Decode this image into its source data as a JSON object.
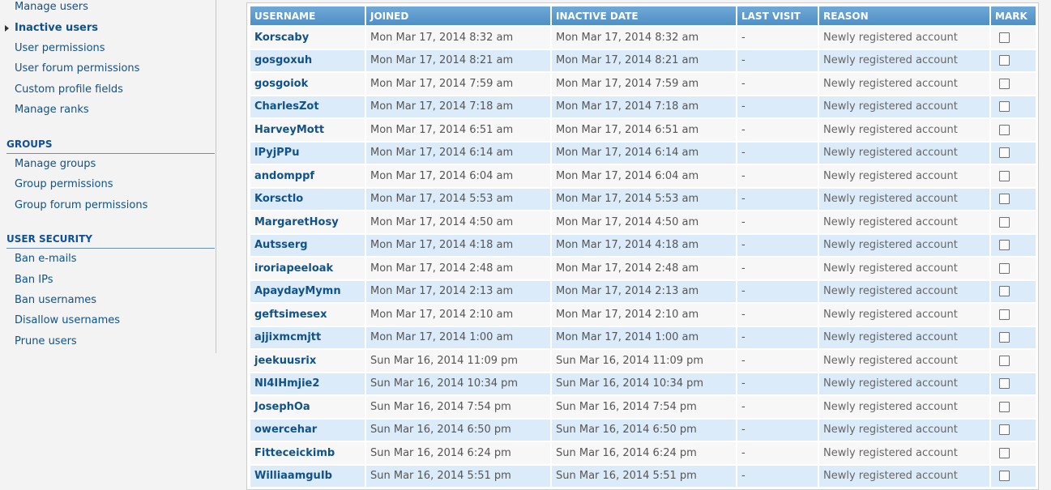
{
  "sidebar": {
    "users_items": [
      {
        "label": "Manage users"
      },
      {
        "label": "Inactive users"
      },
      {
        "label": "User permissions"
      },
      {
        "label": "User forum permissions"
      },
      {
        "label": "Custom profile fields"
      },
      {
        "label": "Manage ranks"
      }
    ],
    "groups_heading": "GROUPS",
    "groups_items": [
      {
        "label": "Manage groups"
      },
      {
        "label": "Group permissions"
      },
      {
        "label": "Group forum permissions"
      }
    ],
    "security_heading": "USER SECURITY",
    "security_items": [
      {
        "label": "Ban e-mails"
      },
      {
        "label": "Ban IPs"
      },
      {
        "label": "Ban usernames"
      },
      {
        "label": "Disallow usernames"
      },
      {
        "label": "Prune users"
      }
    ]
  },
  "table": {
    "headers": {
      "username": "USERNAME",
      "joined": "JOINED",
      "inactive": "INACTIVE DATE",
      "last_visit": "LAST VISIT",
      "reason": "REASON",
      "mark": "MARK"
    },
    "rows": [
      {
        "username": "Korscaby",
        "joined": "Mon Mar 17, 2014 8:32 am",
        "inactive": "Mon Mar 17, 2014 8:32 am",
        "last_visit": "-",
        "reason": "Newly registered account"
      },
      {
        "username": "gosgoxuh",
        "joined": "Mon Mar 17, 2014 8:21 am",
        "inactive": "Mon Mar 17, 2014 8:21 am",
        "last_visit": "-",
        "reason": "Newly registered account"
      },
      {
        "username": "gosgoiok",
        "joined": "Mon Mar 17, 2014 7:59 am",
        "inactive": "Mon Mar 17, 2014 7:59 am",
        "last_visit": "-",
        "reason": "Newly registered account"
      },
      {
        "username": "CharlesZot",
        "joined": "Mon Mar 17, 2014 7:18 am",
        "inactive": "Mon Mar 17, 2014 7:18 am",
        "last_visit": "-",
        "reason": "Newly registered account"
      },
      {
        "username": "HarveyMott",
        "joined": "Mon Mar 17, 2014 6:51 am",
        "inactive": "Mon Mar 17, 2014 6:51 am",
        "last_visit": "-",
        "reason": "Newly registered account"
      },
      {
        "username": "lPyjPPu",
        "joined": "Mon Mar 17, 2014 6:14 am",
        "inactive": "Mon Mar 17, 2014 6:14 am",
        "last_visit": "-",
        "reason": "Newly registered account"
      },
      {
        "username": "andomppf",
        "joined": "Mon Mar 17, 2014 6:04 am",
        "inactive": "Mon Mar 17, 2014 6:04 am",
        "last_visit": "-",
        "reason": "Newly registered account"
      },
      {
        "username": "Korsctlo",
        "joined": "Mon Mar 17, 2014 5:53 am",
        "inactive": "Mon Mar 17, 2014 5:53 am",
        "last_visit": "-",
        "reason": "Newly registered account"
      },
      {
        "username": "MargaretHosy",
        "joined": "Mon Mar 17, 2014 4:50 am",
        "inactive": "Mon Mar 17, 2014 4:50 am",
        "last_visit": "-",
        "reason": "Newly registered account"
      },
      {
        "username": "Autsserg",
        "joined": "Mon Mar 17, 2014 4:18 am",
        "inactive": "Mon Mar 17, 2014 4:18 am",
        "last_visit": "-",
        "reason": "Newly registered account"
      },
      {
        "username": "iroriapeeloak",
        "joined": "Mon Mar 17, 2014 2:48 am",
        "inactive": "Mon Mar 17, 2014 2:48 am",
        "last_visit": "-",
        "reason": "Newly registered account"
      },
      {
        "username": "ApaydayMymn",
        "joined": "Mon Mar 17, 2014 2:13 am",
        "inactive": "Mon Mar 17, 2014 2:13 am",
        "last_visit": "-",
        "reason": "Newly registered account"
      },
      {
        "username": "geftsimesex",
        "joined": "Mon Mar 17, 2014 2:10 am",
        "inactive": "Mon Mar 17, 2014 2:10 am",
        "last_visit": "-",
        "reason": "Newly registered account"
      },
      {
        "username": "ajjixmcmjtt",
        "joined": "Mon Mar 17, 2014 1:00 am",
        "inactive": "Mon Mar 17, 2014 1:00 am",
        "last_visit": "-",
        "reason": "Newly registered account"
      },
      {
        "username": "jeekuusrix",
        "joined": "Sun Mar 16, 2014 11:09 pm",
        "inactive": "Sun Mar 16, 2014 11:09 pm",
        "last_visit": "-",
        "reason": "Newly registered account"
      },
      {
        "username": "Nl4IHmjie2",
        "joined": "Sun Mar 16, 2014 10:34 pm",
        "inactive": "Sun Mar 16, 2014 10:34 pm",
        "last_visit": "-",
        "reason": "Newly registered account"
      },
      {
        "username": "JosephOa",
        "joined": "Sun Mar 16, 2014 7:54 pm",
        "inactive": "Sun Mar 16, 2014 7:54 pm",
        "last_visit": "-",
        "reason": "Newly registered account"
      },
      {
        "username": "owercehar",
        "joined": "Sun Mar 16, 2014 6:50 pm",
        "inactive": "Sun Mar 16, 2014 6:50 pm",
        "last_visit": "-",
        "reason": "Newly registered account"
      },
      {
        "username": "Fitteceickimb",
        "joined": "Sun Mar 16, 2014 6:24 pm",
        "inactive": "Sun Mar 16, 2014 6:24 pm",
        "last_visit": "-",
        "reason": "Newly registered account"
      },
      {
        "username": "WilliaamguIb",
        "joined": "Sun Mar 16, 2014 5:51 pm",
        "inactive": "Sun Mar 16, 2014 5:51 pm",
        "last_visit": "-",
        "reason": "Newly registered account"
      }
    ]
  },
  "colors": {
    "link": "#105289",
    "header_bg": "#5d9ccf",
    "row_alt": "#dcebfa",
    "row_base": "#f7f7f7"
  }
}
